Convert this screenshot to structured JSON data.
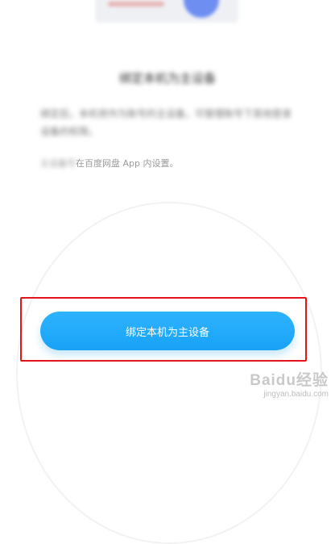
{
  "illustration": {
    "icon": "device-binding-illustration"
  },
  "header": {
    "title": "绑定本机为主设备"
  },
  "content": {
    "description": "绑定后，本机将作为账号的主设备，可管理账号下其他登录设备的权限。",
    "note_blurred": "主设备可",
    "note_visible": "在百度网盘 App 内设置。"
  },
  "actions": {
    "primary_label": "绑定本机为主设备"
  },
  "watermark": {
    "main": "Baidu经验",
    "sub": "jingyan.baidu.com"
  },
  "colors": {
    "primary": "#1ea8fb",
    "highlight": "#e3141b"
  }
}
